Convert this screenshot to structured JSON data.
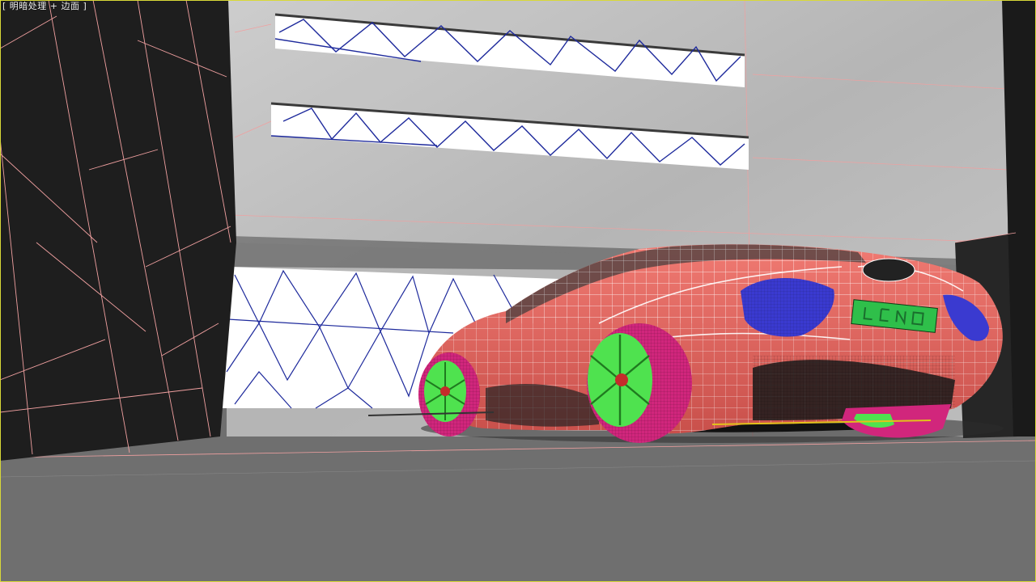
{
  "viewport": {
    "label": "[ 明暗处理 + 边面 ]",
    "mode": "perspective",
    "active_border_color": "#d8d838"
  },
  "scene": {
    "objects": [
      "left-dark-panel-wall",
      "concrete-building",
      "glass-windows",
      "ground-plane",
      "sports-car",
      "car-wheels",
      "rear-license-plate",
      "dark-pillar-right"
    ],
    "colors": {
      "car_body": "#e0625d",
      "car_wire": "#ffffff",
      "wheel_rim": "#4fe24f",
      "tire": "#d1267c",
      "rear_glass": "#3a3ad0",
      "plate": "#2fbf4a",
      "wall_dark": "#1e1e1e",
      "concrete": "#c9c9c9",
      "window_glass": "#ffffff",
      "window_wire": "#1e2a9c",
      "ground": "#6f6f6f",
      "edge_wire": "#f0a0a0"
    }
  }
}
